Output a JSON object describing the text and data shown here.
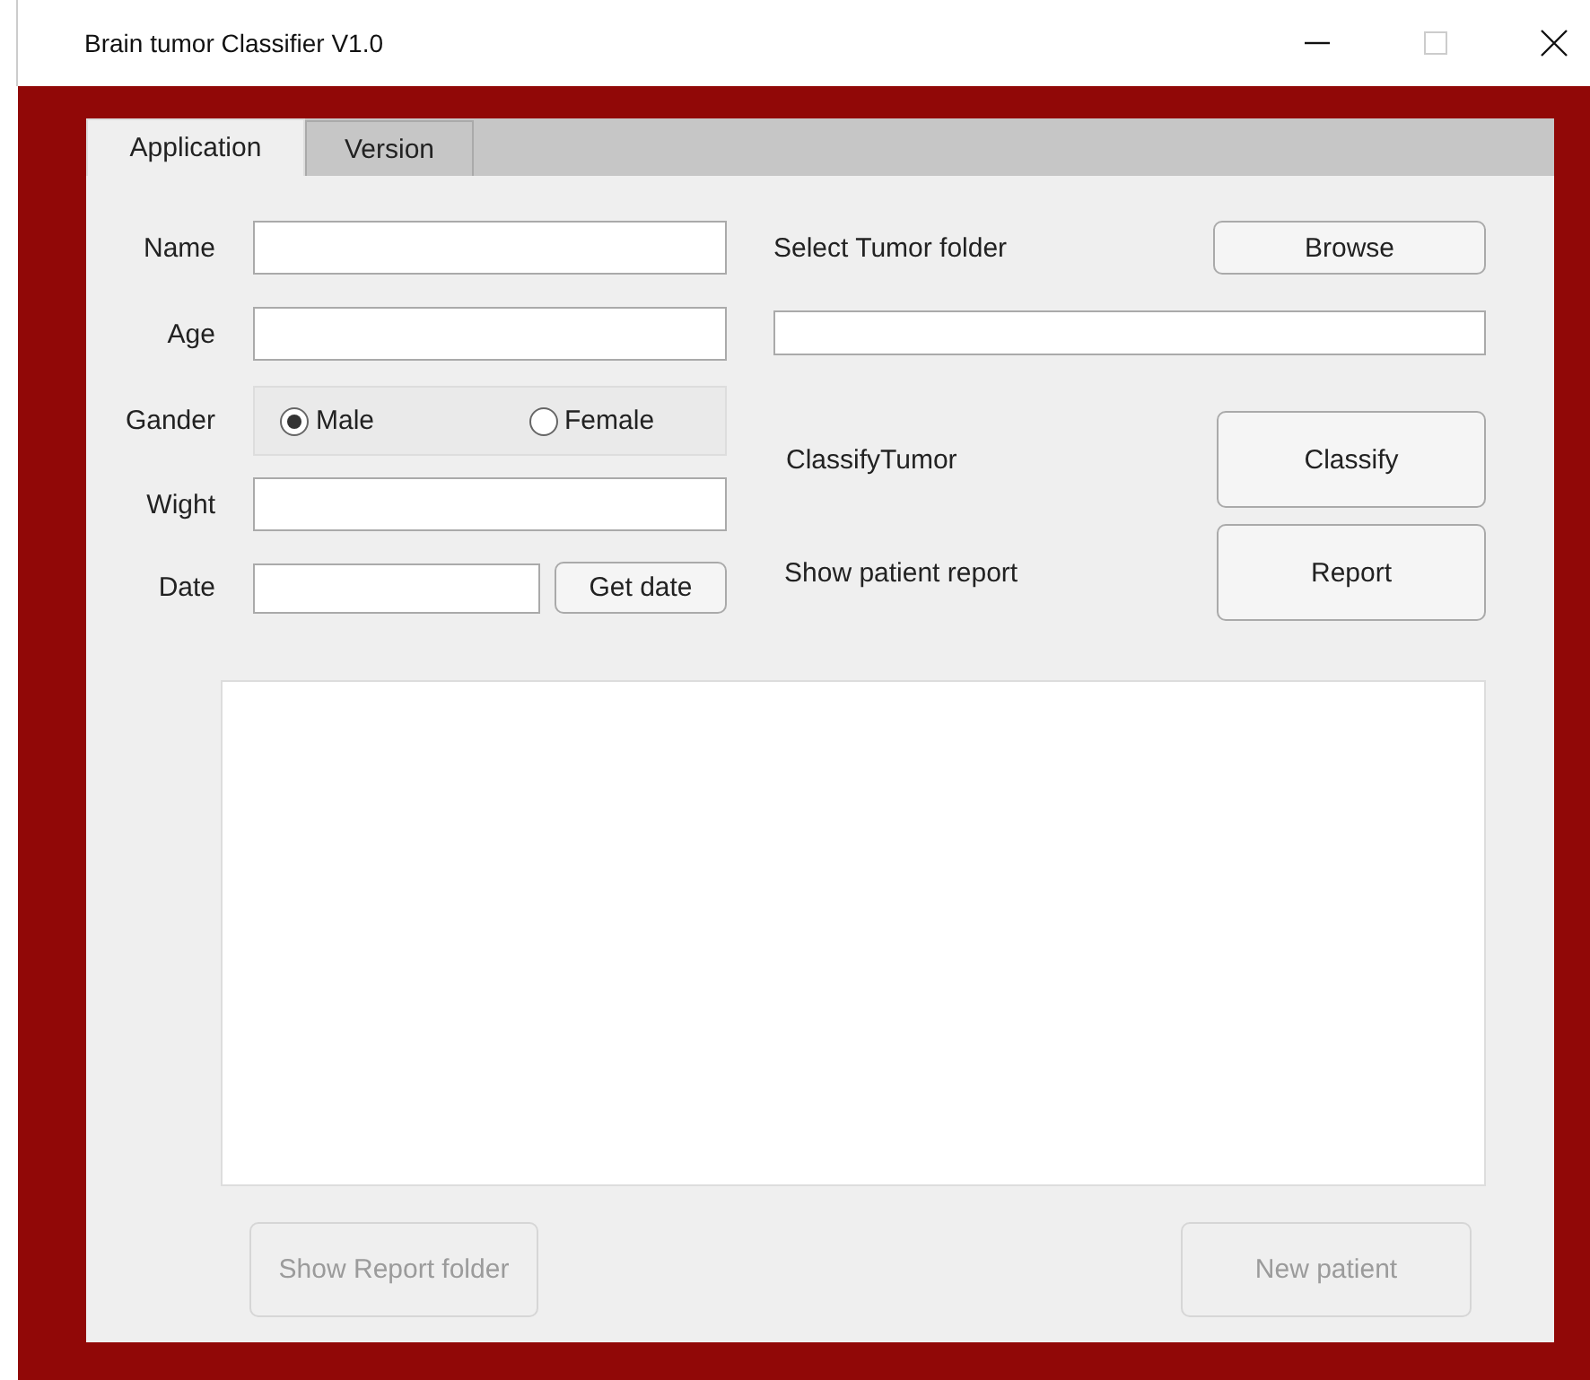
{
  "window": {
    "title": "Brain tumor Classifier V1.0"
  },
  "tabs": [
    {
      "label": "Application",
      "selected": true
    },
    {
      "label": "Version",
      "selected": false
    }
  ],
  "form": {
    "fields": [
      {
        "kind": "text",
        "label": "Name"
      },
      {
        "kind": "text",
        "label": "Age"
      },
      {
        "kind": "radio",
        "label": "Gander",
        "options": [
          {
            "label": "Male",
            "selected": true
          },
          {
            "label": "Female",
            "selected": false
          }
        ]
      },
      {
        "kind": "text",
        "label": "Wight"
      },
      {
        "kind": "date",
        "label": "Date",
        "button": "Get date"
      }
    ]
  },
  "actions": {
    "folder_label": "Select Tumor folder",
    "browse_button": "Browse",
    "classify_label": "ClassifyTumor",
    "classify_button": "Classify",
    "report_label": "Show patient report",
    "report_button": "Report"
  },
  "bottom_buttons": [
    {
      "label": "Show Report folder",
      "disabled": true
    },
    {
      "label": "New patient",
      "disabled": true
    }
  ]
}
